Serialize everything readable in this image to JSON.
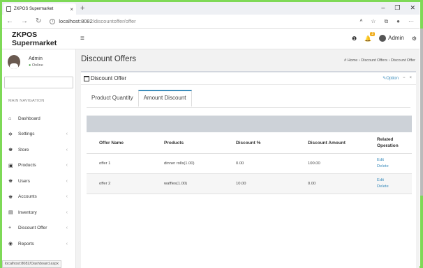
{
  "browser": {
    "tab_title": "ZKPOS Supermarket",
    "tab_close": "×",
    "new_tab": "+",
    "url_host": "localhost:8082",
    "url_path": "/discountoffer/offer",
    "status_url": "localhost:8082/Dashboard.aspx"
  },
  "app": {
    "brand": "ZKPOS Supermarket",
    "user_name": "Admin",
    "user_status": "Online",
    "badge_count": "2"
  },
  "sidebar": {
    "header": "MAIN NAVIGATION",
    "items": [
      {
        "label": "Dashboard",
        "icon": "⌂"
      },
      {
        "label": "Settings",
        "icon": "✲"
      },
      {
        "label": "Store",
        "icon": "♚"
      },
      {
        "label": "Products",
        "icon": "▣"
      },
      {
        "label": "Users",
        "icon": "♚"
      },
      {
        "label": "Accounts",
        "icon": "♚"
      },
      {
        "label": "Inventory",
        "icon": "▤"
      },
      {
        "label": "Discount Offer",
        "icon": "+"
      },
      {
        "label": "Reports",
        "icon": "◉"
      }
    ]
  },
  "page": {
    "title": "Discount Offers",
    "breadcrumb": "# Home  ›  Discount Offers  ›  Discount Offer",
    "box_title": "Discount Offer",
    "box_option": "Option",
    "tabs": [
      "Product Quantity",
      "Amount Discount"
    ],
    "columns": [
      "Offer Name",
      "Products",
      "Discount %",
      "Discount Amount",
      "Related Operation"
    ],
    "rows": [
      {
        "name": "offer 1",
        "products": "dinner rolls(1.00)",
        "discount_pct": "0.00",
        "discount_amount": "100.00",
        "edit": "Edit",
        "delete": "Delete"
      },
      {
        "name": "offer 2",
        "products": "waffles(1.00)",
        "discount_pct": "10.00",
        "discount_amount": "0.00",
        "edit": "Edit",
        "delete": "Delete"
      }
    ]
  }
}
